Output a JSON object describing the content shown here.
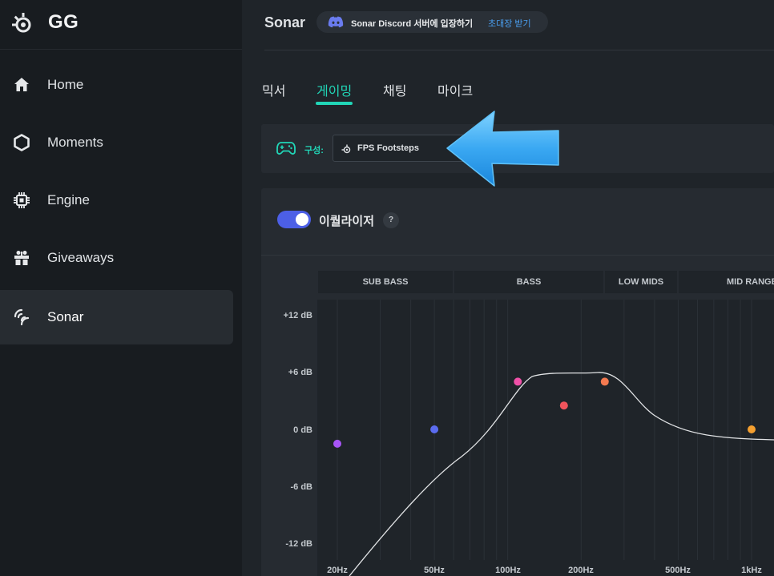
{
  "brand": {
    "title": "GG"
  },
  "sidebar": {
    "items": [
      {
        "label": "Home",
        "icon": "home-icon"
      },
      {
        "label": "Moments",
        "icon": "hexagon-icon"
      },
      {
        "label": "Engine",
        "icon": "chip-icon"
      },
      {
        "label": "Giveaways",
        "icon": "gift-icon"
      },
      {
        "label": "Sonar",
        "icon": "sonar-icon",
        "active": true
      }
    ]
  },
  "header": {
    "title": "Sonar",
    "discord_text": "Sonar Discord 서버에 입장하기",
    "discord_link": "초대장 받기"
  },
  "tabs": [
    {
      "label": "믹서"
    },
    {
      "label": "게이밍",
      "active": true
    },
    {
      "label": "채팅"
    },
    {
      "label": "마이크"
    }
  ],
  "config": {
    "label": "구성:",
    "selected": "FPS Footsteps"
  },
  "equalizer": {
    "label": "이퀄라이저",
    "help": "?",
    "enabled": true,
    "bands": [
      "SUB BASS",
      "BASS",
      "LOW MIDS",
      "MID RANGE"
    ],
    "db_labels": [
      "+12 dB",
      "+6 dB",
      "0 dB",
      "-6 dB",
      "-12 dB"
    ],
    "hz_labels": [
      "20Hz",
      "50Hz",
      "100Hz",
      "200Hz",
      "500Hz",
      "1kHz"
    ],
    "points": [
      {
        "freq": 20,
        "gain": -1.5,
        "color": "#a855f7"
      },
      {
        "freq": 50,
        "gain": 0,
        "color": "#5b6cf0"
      },
      {
        "freq": 110,
        "gain": 5,
        "color": "#f050a8"
      },
      {
        "freq": 170,
        "gain": 2.5,
        "color": "#f0545c"
      },
      {
        "freq": 250,
        "gain": 5,
        "color": "#f47a50"
      },
      {
        "freq": 1000,
        "gain": 0,
        "color": "#f5a030"
      }
    ]
  },
  "colors": {
    "accent": "#21d6b7",
    "toggle": "#4c5fe6",
    "link": "#4a9ff0"
  }
}
